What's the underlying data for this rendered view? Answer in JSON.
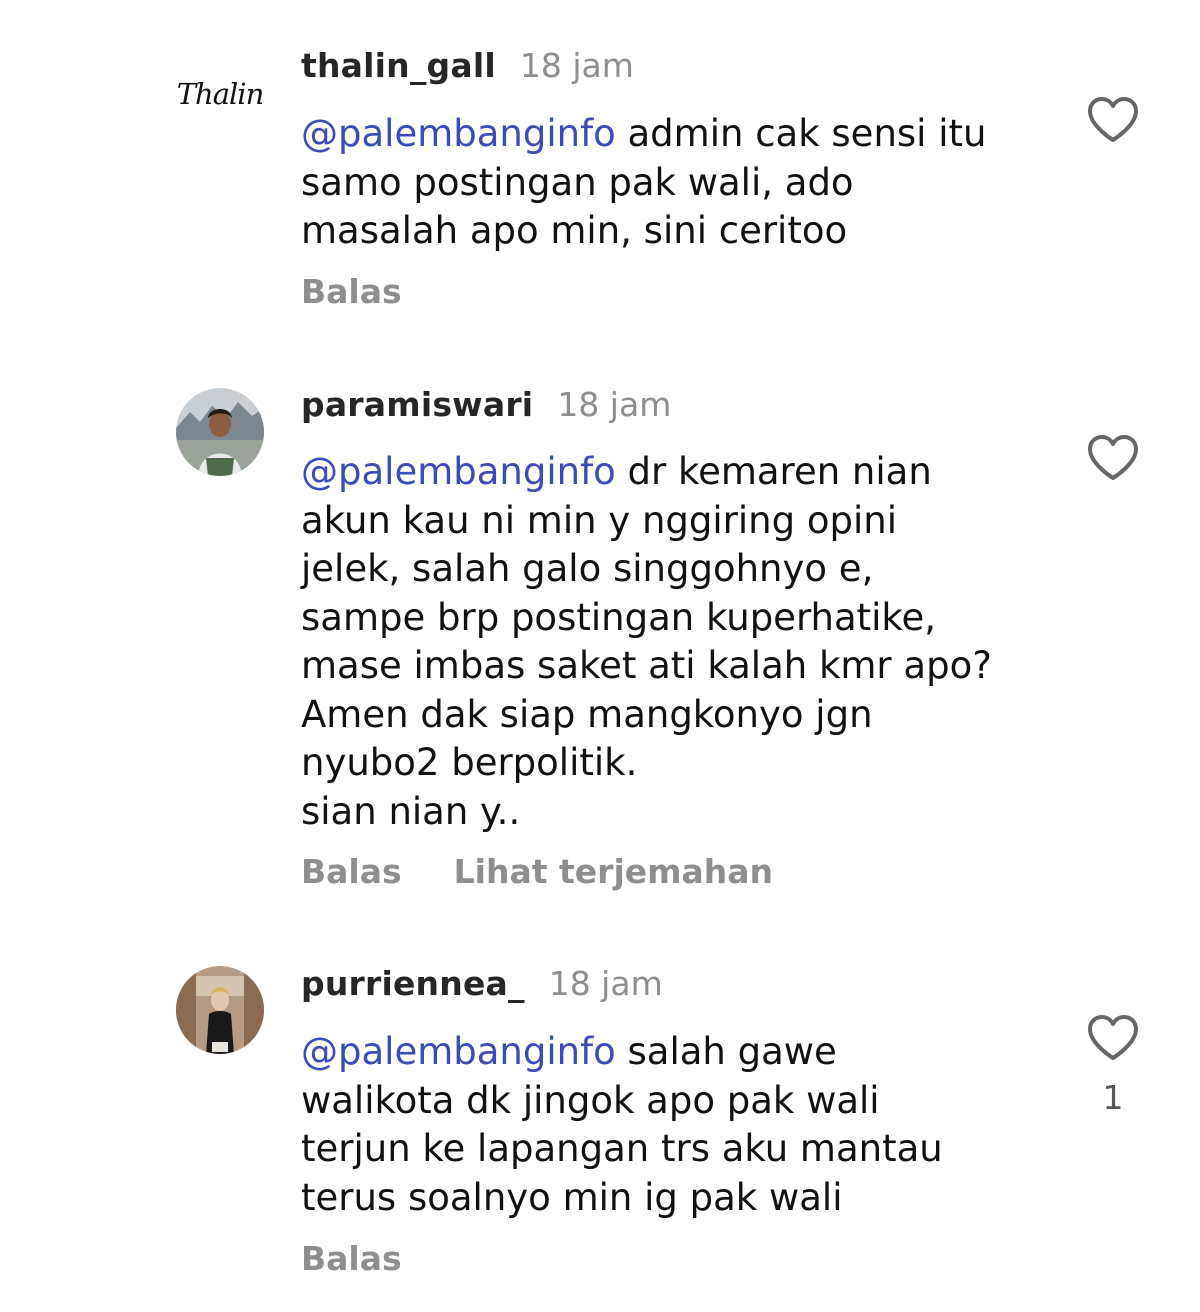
{
  "comments": [
    {
      "username": "thalin_gall",
      "time": "18 jam",
      "avatar_text": "Thalin",
      "mention": "@palembanginfo",
      "text": " admin cak sensi itu\nsamo postingan pak wali, ado\nmasalah apo min, sini ceritoo",
      "reply_label": "Balas",
      "like_icon": "heart-outline-icon"
    },
    {
      "username": "paramiswari",
      "time": "18 jam",
      "mention": "@palembanginfo",
      "text": " dr kemaren nian\nakun kau ni min y nggiring opini\njelek, salah galo singgohnyo e,\nsampe brp postingan kuperhatike,\nmase imbas saket ati kalah kmr apo?\nAmen dak siap mangkonyo jgn\nnyubo2 berpolitik.\nsian nian y..",
      "reply_label": "Balas",
      "translate_label": "Lihat terjemahan",
      "like_icon": "heart-outline-icon"
    },
    {
      "username": "purriennea_",
      "time": "18 jam",
      "mention": "@palembanginfo",
      "text": " salah gawe\nwalikota dk jingok apo pak wali\nterjun ke lapangan trs aku mantau\nterus soalnyo min ig pak wali",
      "reply_label": "Balas",
      "like_count": "1",
      "like_icon": "heart-outline-icon"
    }
  ],
  "colors": {
    "mention": "#3b4bb8",
    "muted": "#8e8e8e",
    "text": "#111111"
  }
}
